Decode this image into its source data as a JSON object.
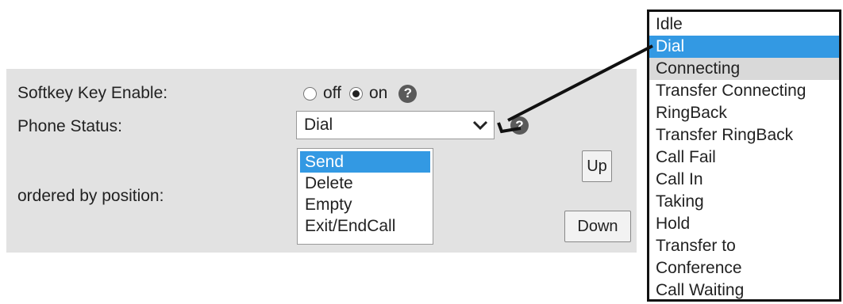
{
  "form": {
    "softkey_label": "Softkey Key Enable:",
    "phone_status_label": "Phone Status:",
    "ordered_label": "ordered by position:"
  },
  "softkey": {
    "off_label": "off",
    "on_label": "on",
    "selected": "on"
  },
  "help_icon_glyph": "?",
  "phone_status": {
    "selected_value": "Dial"
  },
  "position_list": {
    "items": [
      "Send",
      "Delete",
      "Empty",
      "Exit/EndCall"
    ],
    "selected": "Send"
  },
  "buttons": {
    "up": "Up",
    "down": "Down"
  },
  "dropdown": {
    "options": [
      "Idle",
      "Dial",
      "Connecting",
      "Transfer Connecting",
      "RingBack",
      "Transfer RingBack",
      "Call Fail",
      "Call In",
      "Taking",
      "Hold",
      "Transfer to",
      "Conference",
      "Call Waiting"
    ],
    "selected": "Dial",
    "hovered": "Connecting"
  },
  "colors": {
    "panel_bg": "#e2e2e2",
    "selection": "#3399e3",
    "hover": "#d9d9d9",
    "help_icon": "#5a5a5a"
  }
}
